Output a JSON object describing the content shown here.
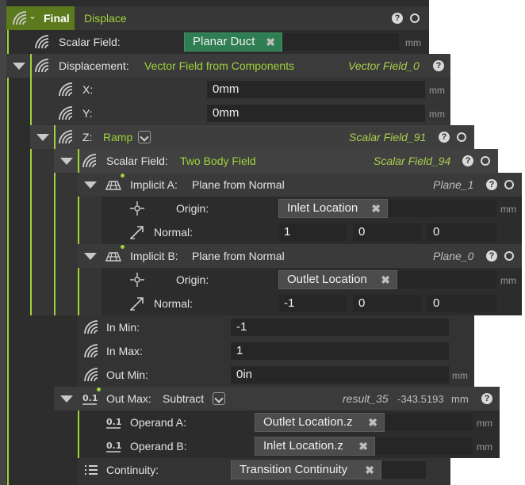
{
  "colors": {
    "accent": "#9fd33b",
    "panel_dark": "#2f2f2f",
    "panel_mid": "#3a3a3a",
    "field_bg": "#262626"
  },
  "root": {
    "title": "Final",
    "subtitle": "Displace"
  },
  "scalar_field": {
    "label": "Scalar Field:",
    "value": "Planar Duct",
    "unit": "mm"
  },
  "displacement": {
    "label": "Displacement:",
    "type": "Vector Field from Components",
    "instance": "Vector Field_0",
    "x": {
      "label": "X:",
      "value": "0mm",
      "unit": "mm"
    },
    "y": {
      "label": "Y:",
      "value": "0mm",
      "unit": "mm"
    },
    "z": {
      "label": "Z:",
      "type": "Ramp",
      "instance": "Scalar Field_91",
      "scalar_field": {
        "label": "Scalar Field:",
        "type": "Two Body Field",
        "instance": "Scalar Field_94",
        "implicit_a": {
          "label": "Implicit A:",
          "type": "Plane from Normal",
          "instance": "Plane_1",
          "origin": {
            "label": "Origin:",
            "value": "Inlet Location",
            "unit": "mm"
          },
          "normal": {
            "label": "Normal:",
            "values": [
              "1",
              "0",
              "0"
            ]
          }
        },
        "implicit_b": {
          "label": "Implicit B:",
          "type": "Plane from Normal",
          "instance": "Plane_0",
          "origin": {
            "label": "Origin:",
            "value": "Outlet Location",
            "unit": "mm"
          },
          "normal": {
            "label": "Normal:",
            "values": [
              "-1",
              "0",
              "0"
            ]
          }
        }
      },
      "in_min": {
        "label": "In Min:",
        "value": "-1"
      },
      "in_max": {
        "label": "In Max:",
        "value": "1"
      },
      "out_min": {
        "label": "Out Min:",
        "value": "0in",
        "unit": "mm"
      },
      "out_max": {
        "label": "Out Max:",
        "type": "Subtract",
        "instance": "result_35",
        "result": "-343.5193",
        "result_unit": "mm",
        "operand_a": {
          "label": "Operand A:",
          "value": "Outlet Location.z",
          "unit": "mm"
        },
        "operand_b": {
          "label": "Operand B:",
          "value": "Inlet Location.z",
          "unit": "mm"
        }
      },
      "continuity": {
        "label": "Continuity:",
        "value": "Transition Continuity"
      }
    }
  },
  "icons": {
    "field": "field-wave-icon",
    "vector": "vector-field-icon",
    "plane": "plane-icon",
    "origin": "origin-crosshair-icon",
    "normal": "normal-arrow-icon",
    "subtract": "number-value-icon",
    "list": "list-icon",
    "help": "help-icon",
    "circle": "circle-toggle-icon",
    "remove": "remove-x-icon",
    "expand": "expand-triangle-icon",
    "dropdown": "chevron-down-icon"
  }
}
